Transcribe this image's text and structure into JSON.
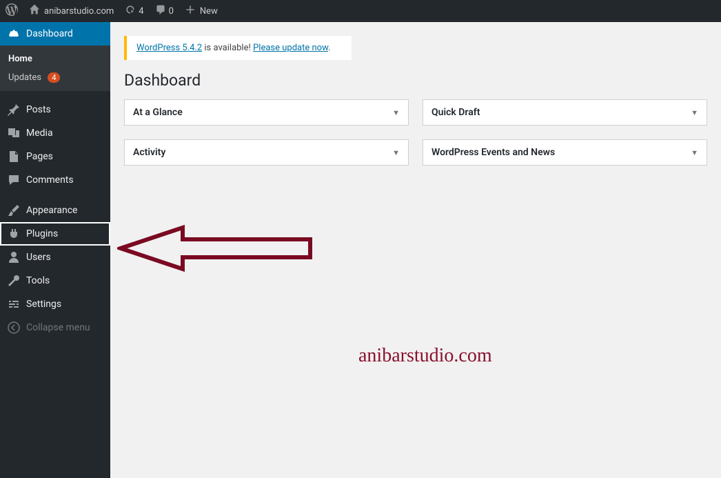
{
  "adminBar": {
    "siteName": "anibarstudio.com",
    "updatesCount": "4",
    "commentsCount": "0",
    "newLabel": "New"
  },
  "sidebar": {
    "dashboard": "Dashboard",
    "home": "Home",
    "updates": "Updates",
    "updatesBadge": "4",
    "posts": "Posts",
    "media": "Media",
    "pages": "Pages",
    "comments": "Comments",
    "appearance": "Appearance",
    "plugins": "Plugins",
    "users": "Users",
    "tools": "Tools",
    "settings": "Settings",
    "collapse": "Collapse menu"
  },
  "notice": {
    "version": "WordPress 5.4.2",
    "availableText": " is available! ",
    "updateLink": "Please update now",
    "period": "."
  },
  "pageTitle": "Dashboard",
  "boxes": {
    "atAGlance": "At a Glance",
    "activity": "Activity",
    "quickDraft": "Quick Draft",
    "events": "WordPress Events and News"
  },
  "watermark": "anibarstudio.com"
}
